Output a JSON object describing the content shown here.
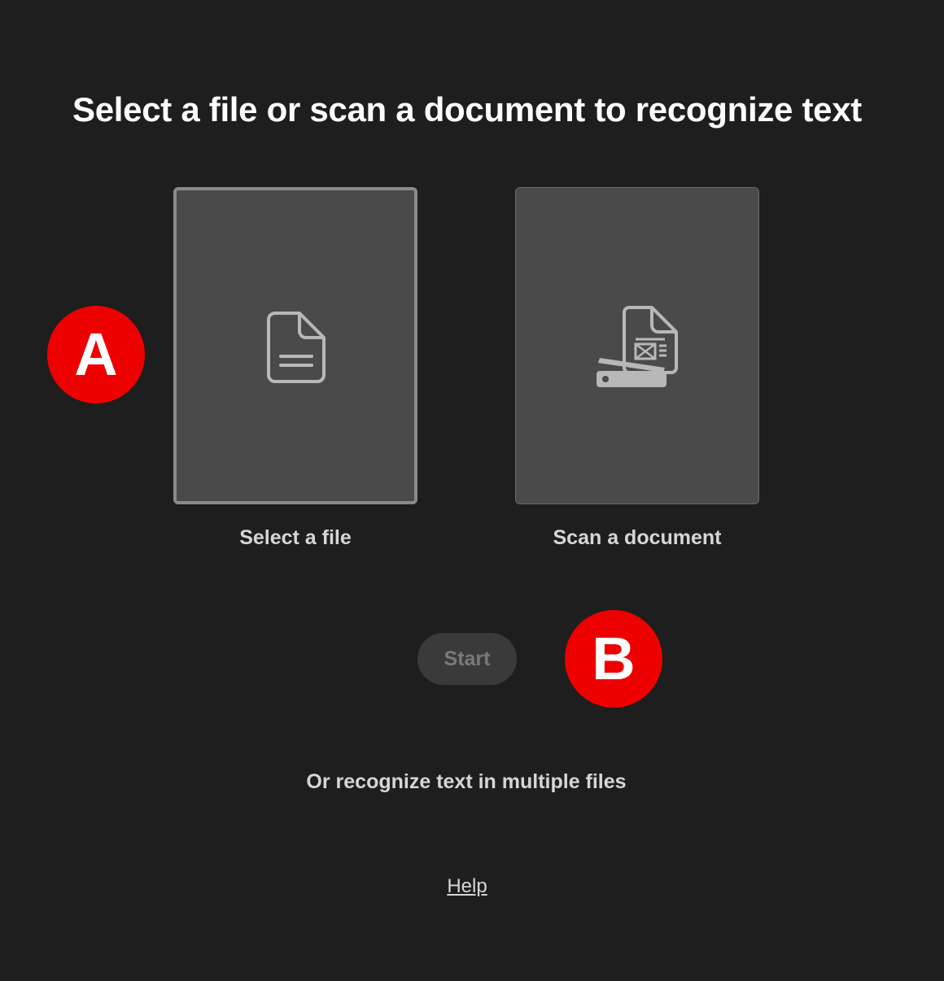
{
  "page": {
    "title": "Select a file or scan a document to recognize text"
  },
  "options": [
    {
      "label": "Select a file",
      "icon": "document-icon",
      "selected": true
    },
    {
      "label": "Scan a document",
      "icon": "scanner-icon",
      "selected": false
    }
  ],
  "markers": {
    "a": "A",
    "b": "B"
  },
  "actions": {
    "start_label": "Start",
    "start_enabled": false,
    "multiple_files_label": "Or recognize text in multiple files",
    "help_label": "Help"
  },
  "colors": {
    "background": "#1e1e1e",
    "card": "#4a4a4a",
    "marker": "#ee0000"
  }
}
